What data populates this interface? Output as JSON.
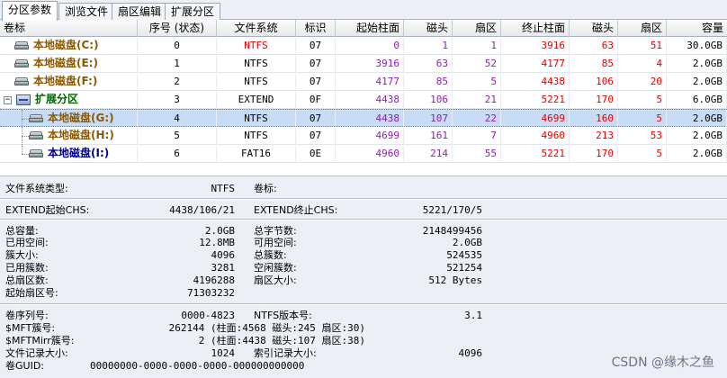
{
  "tabs": [
    "分区参数",
    "浏览文件",
    "扇区编辑",
    "扩展分区"
  ],
  "columns": [
    "卷标",
    "序号 (状态)",
    "文件系统",
    "标识",
    "起始柱面",
    "磁头",
    "扇区",
    "终止柱面",
    "磁头",
    "扇区",
    "容量"
  ],
  "rows": [
    {
      "name": "本地磁盘(C:)",
      "num": "0",
      "fs": "NTFS",
      "id": "07",
      "sc": "0",
      "sh": "1",
      "ss": "1",
      "ec": "3916",
      "eh": "63",
      "es": "51",
      "size": "30.0GB",
      "color": "#8a5a00"
    },
    {
      "name": "本地磁盘(E:)",
      "num": "1",
      "fs": "NTFS",
      "id": "07",
      "sc": "3916",
      "sh": "63",
      "ss": "52",
      "ec": "4177",
      "eh": "85",
      "es": "4",
      "size": "2.0GB",
      "color": "#8a5a00"
    },
    {
      "name": "本地磁盘(F:)",
      "num": "2",
      "fs": "NTFS",
      "id": "07",
      "sc": "4177",
      "sh": "85",
      "ss": "5",
      "ec": "4438",
      "eh": "106",
      "es": "20",
      "size": "2.0GB",
      "color": "#8a5a00"
    },
    {
      "name": "扩展分区",
      "num": "3",
      "fs": "EXTEND",
      "id": "0F",
      "sc": "4438",
      "sh": "106",
      "ss": "21",
      "ec": "5221",
      "eh": "170",
      "es": "5",
      "size": "6.0GB",
      "color": "#006400"
    },
    {
      "name": "本地磁盘(G:)",
      "num": "4",
      "fs": "NTFS",
      "id": "07",
      "sc": "4438",
      "sh": "107",
      "ss": "22",
      "ec": "4699",
      "eh": "160",
      "es": "5",
      "size": "2.0GB",
      "color": "#8a5a00"
    },
    {
      "name": "本地磁盘(H:)",
      "num": "5",
      "fs": "NTFS",
      "id": "07",
      "sc": "4699",
      "sh": "161",
      "ss": "7",
      "ec": "4960",
      "eh": "213",
      "es": "53",
      "size": "2.0GB",
      "color": "#8a5a00"
    },
    {
      "name": "本地磁盘(I:)",
      "num": "6",
      "fs": "FAT16",
      "id": "0E",
      "sc": "4960",
      "sh": "214",
      "ss": "55",
      "ec": "5221",
      "eh": "170",
      "es": "5",
      "size": "2.0GB",
      "color": "#00008b"
    }
  ],
  "info": {
    "fs_type_label": "文件系统类型:",
    "fs_type_value": "NTFS",
    "volume_label_label": "卷标:",
    "volume_label_value": "",
    "ext_start_label": "EXTEND起始CHS:",
    "ext_start_value": "4438/106/21",
    "ext_end_label": "EXTEND终止CHS:",
    "ext_end_value": "5221/170/5",
    "total_cap_label": "总容量:",
    "total_cap_value": "2.0GB",
    "total_bytes_label": "总字节数:",
    "total_bytes_value": "2148499456",
    "used_space_label": "已用空间:",
    "used_space_value": "12.8MB",
    "free_space_label": "可用空间:",
    "free_space_value": "2.0GB",
    "cluster_size_label": "簇大小:",
    "cluster_size_value": "4096",
    "total_clusters_label": "总簇数:",
    "total_clusters_value": "524535",
    "used_clusters_label": "已用簇数:",
    "used_clusters_value": "3281",
    "free_clusters_label": "空闲簇数:",
    "free_clusters_value": "521254",
    "total_sectors_label": "总扇区数:",
    "total_sectors_value": "4196288",
    "sector_size_label": "扇区大小:",
    "sector_size_value": "512 Bytes",
    "start_sector_label": "起始扇区号:",
    "start_sector_value": "71303232",
    "serial_label": "卷序列号:",
    "serial_value": "0000-4823",
    "ntfs_ver_label": "NTFS版本号:",
    "ntfs_ver_value": "3.1",
    "mft_label": "$MFT簇号:",
    "mft_value": "262144 (柱面:4568 磁头:245 扇区:30)",
    "mftmirr_label": "$MFTMirr簇号:",
    "mftmirr_value": "2 (柱面:4438 磁头:107 扇区:38)",
    "file_rec_label": "文件记录大小:",
    "file_rec_value": "1024",
    "index_rec_label": "索引记录大小:",
    "index_rec_value": "4096",
    "guid_label": "卷GUID:",
    "guid_value": "00000000-0000-0000-0000-000000000000"
  },
  "watermark": "CSDN @缘木之鱼"
}
